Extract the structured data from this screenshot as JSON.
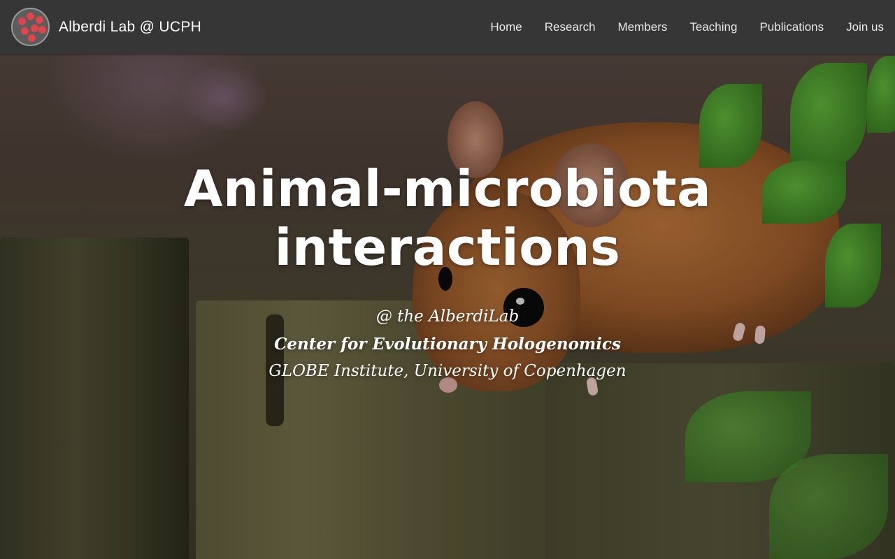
{
  "brand": {
    "title": "Alberdi Lab @ UCPH",
    "logo_icon": "paw-print-logo-icon"
  },
  "nav": {
    "items": [
      {
        "label": "Home"
      },
      {
        "label": "Research"
      },
      {
        "label": "Members"
      },
      {
        "label": "Teaching"
      },
      {
        "label": "Publications"
      },
      {
        "label": "Join us"
      }
    ]
  },
  "hero": {
    "headline_line1": "Animal-microbiota",
    "headline_line2": "interactions",
    "sub_line1": "@ the AlberdiLab",
    "sub_line2": "Center for Evolutionary Hologenomics",
    "sub_line3": "GLOBE Institute, University of Copenhagen",
    "background_image": "mouse-on-wooden-post-photo"
  },
  "colors": {
    "navbar": "#363636",
    "logo_accent": "#e0444c",
    "text": "#ffffff"
  }
}
